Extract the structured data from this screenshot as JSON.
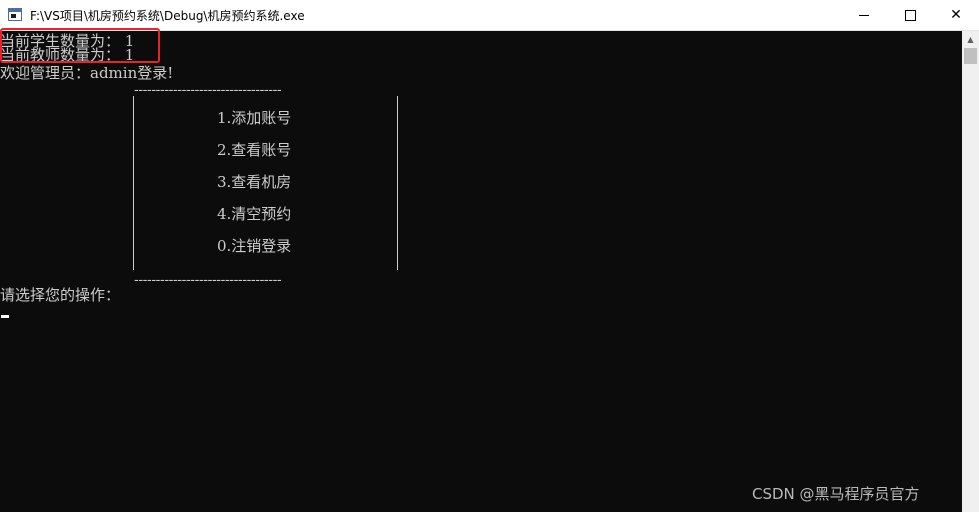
{
  "window": {
    "title": "F:\\VS项目\\机房预约系统\\Debug\\机房预约系统.exe",
    "min_icon": "minimize-icon",
    "max_icon": "maximize-icon",
    "close_glyph": "✕"
  },
  "console": {
    "student_count_line": "当前学生数量为： 1",
    "teacher_count_line": "当前教师数量为： 1",
    "welcome_line": "欢迎管理员：admin登录!",
    "menu_border_top": "----------------------------------",
    "menu_border_bottom": "----------------------------------",
    "menu_items": [
      "1.添加账号",
      "2.查看账号",
      "3.查看机房",
      "4.清空预约",
      "0.注销登录"
    ],
    "prompt_line": "请选择您的操作："
  },
  "annotation": {
    "highlight_color": "#e8242a"
  },
  "watermark": {
    "text": "CSDN @黑马程序员官方"
  },
  "colors": {
    "console_bg": "#0c0c0c",
    "console_fg": "#cccccc"
  }
}
